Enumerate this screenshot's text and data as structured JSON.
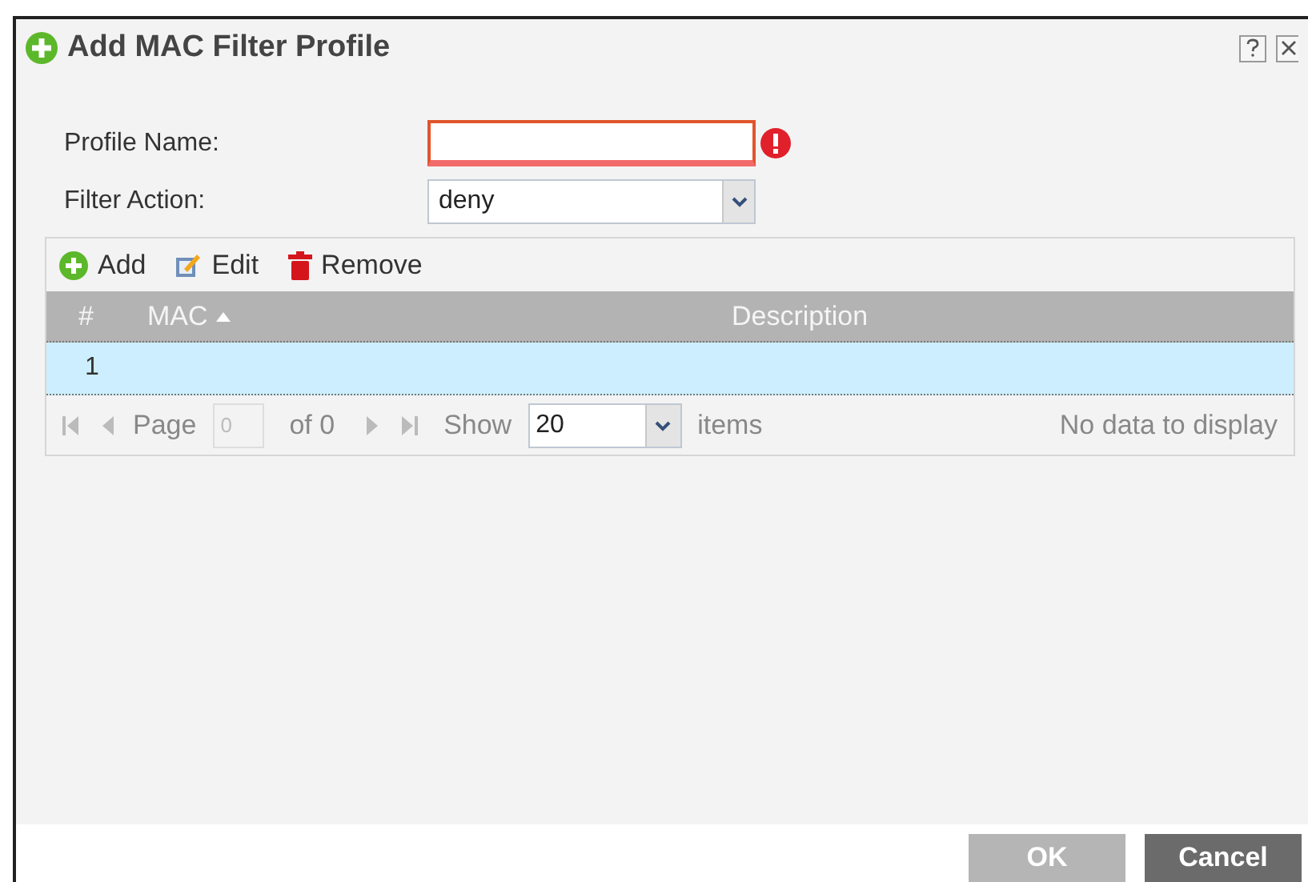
{
  "dialog": {
    "title": "Add MAC Filter Profile"
  },
  "form": [
    {
      "kind": "text",
      "label": "Profile Name:",
      "invalid": true
    },
    {
      "kind": "select",
      "label": "Filter Action:",
      "value": "deny"
    }
  ],
  "toolbar": [
    {
      "kind": "add",
      "label": "Add"
    },
    {
      "kind": "edit",
      "label": "Edit"
    },
    {
      "kind": "remove",
      "label": "Remove"
    }
  ],
  "table": {
    "columns": [
      {
        "label": "#",
        "sorted": false
      },
      {
        "label": "MAC",
        "sorted": true
      },
      {
        "label": "Description",
        "sorted": false
      }
    ],
    "rows": [
      {
        "cells": [
          "1",
          "",
          ""
        ],
        "selected": true
      }
    ]
  },
  "pager": {
    "page_label": "Page",
    "page_value": "0",
    "of_label": "of 0",
    "show_label": "Show",
    "show_value": "20",
    "items_label": "items",
    "status": "No data to display"
  },
  "buttons": [
    {
      "label": "OK",
      "kind": "primary",
      "disabled": true
    },
    {
      "label": "Cancel",
      "kind": "secondary",
      "disabled": false
    }
  ]
}
